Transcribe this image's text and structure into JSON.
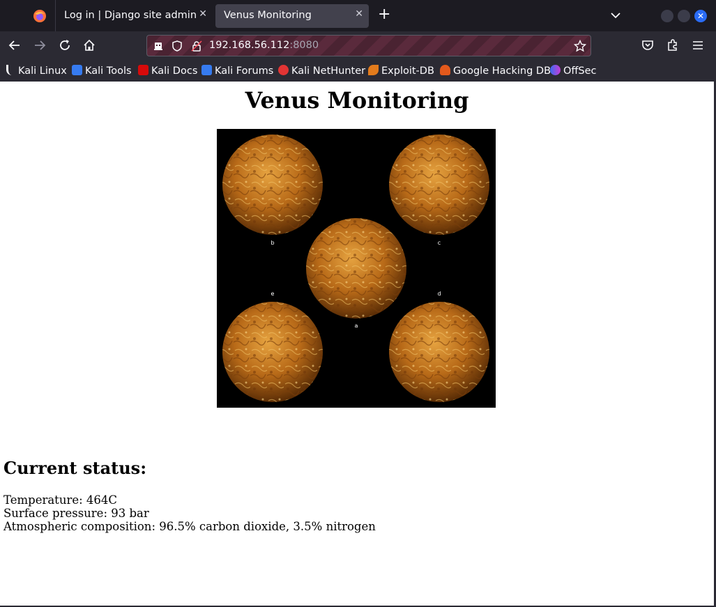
{
  "browser": {
    "tabs": [
      {
        "label": "Log in | Django site admin"
      },
      {
        "label": "Venus Monitoring"
      }
    ],
    "url": {
      "host": "192.168.56.112",
      "port": ":8080"
    },
    "bookmarks": [
      {
        "label": "Kali Linux",
        "icon": "kali-dragon-icon"
      },
      {
        "label": "Kali Tools",
        "icon": "kali-tools-icon"
      },
      {
        "label": "Kali Docs",
        "icon": "kali-docs-icon"
      },
      {
        "label": "Kali Forums",
        "icon": "kali-forums-icon"
      },
      {
        "label": "Kali NetHunter",
        "icon": "kali-nethunter-icon"
      },
      {
        "label": "Exploit-DB",
        "icon": "exploit-db-icon"
      },
      {
        "label": "Google Hacking DB",
        "icon": "ghdb-icon"
      },
      {
        "label": "OffSec",
        "icon": "offsec-icon"
      }
    ],
    "accent": "#2a6cf6"
  },
  "page": {
    "title": "Venus Monitoring",
    "image": {
      "labels": [
        "b",
        "c",
        "a",
        "e",
        "d"
      ]
    },
    "status_heading": "Current status:",
    "status_lines": [
      "Temperature: 464C",
      "Surface pressure: 93 bar",
      "Atmospheric composition: 96.5% carbon dioxide, 3.5% nitrogen"
    ]
  }
}
